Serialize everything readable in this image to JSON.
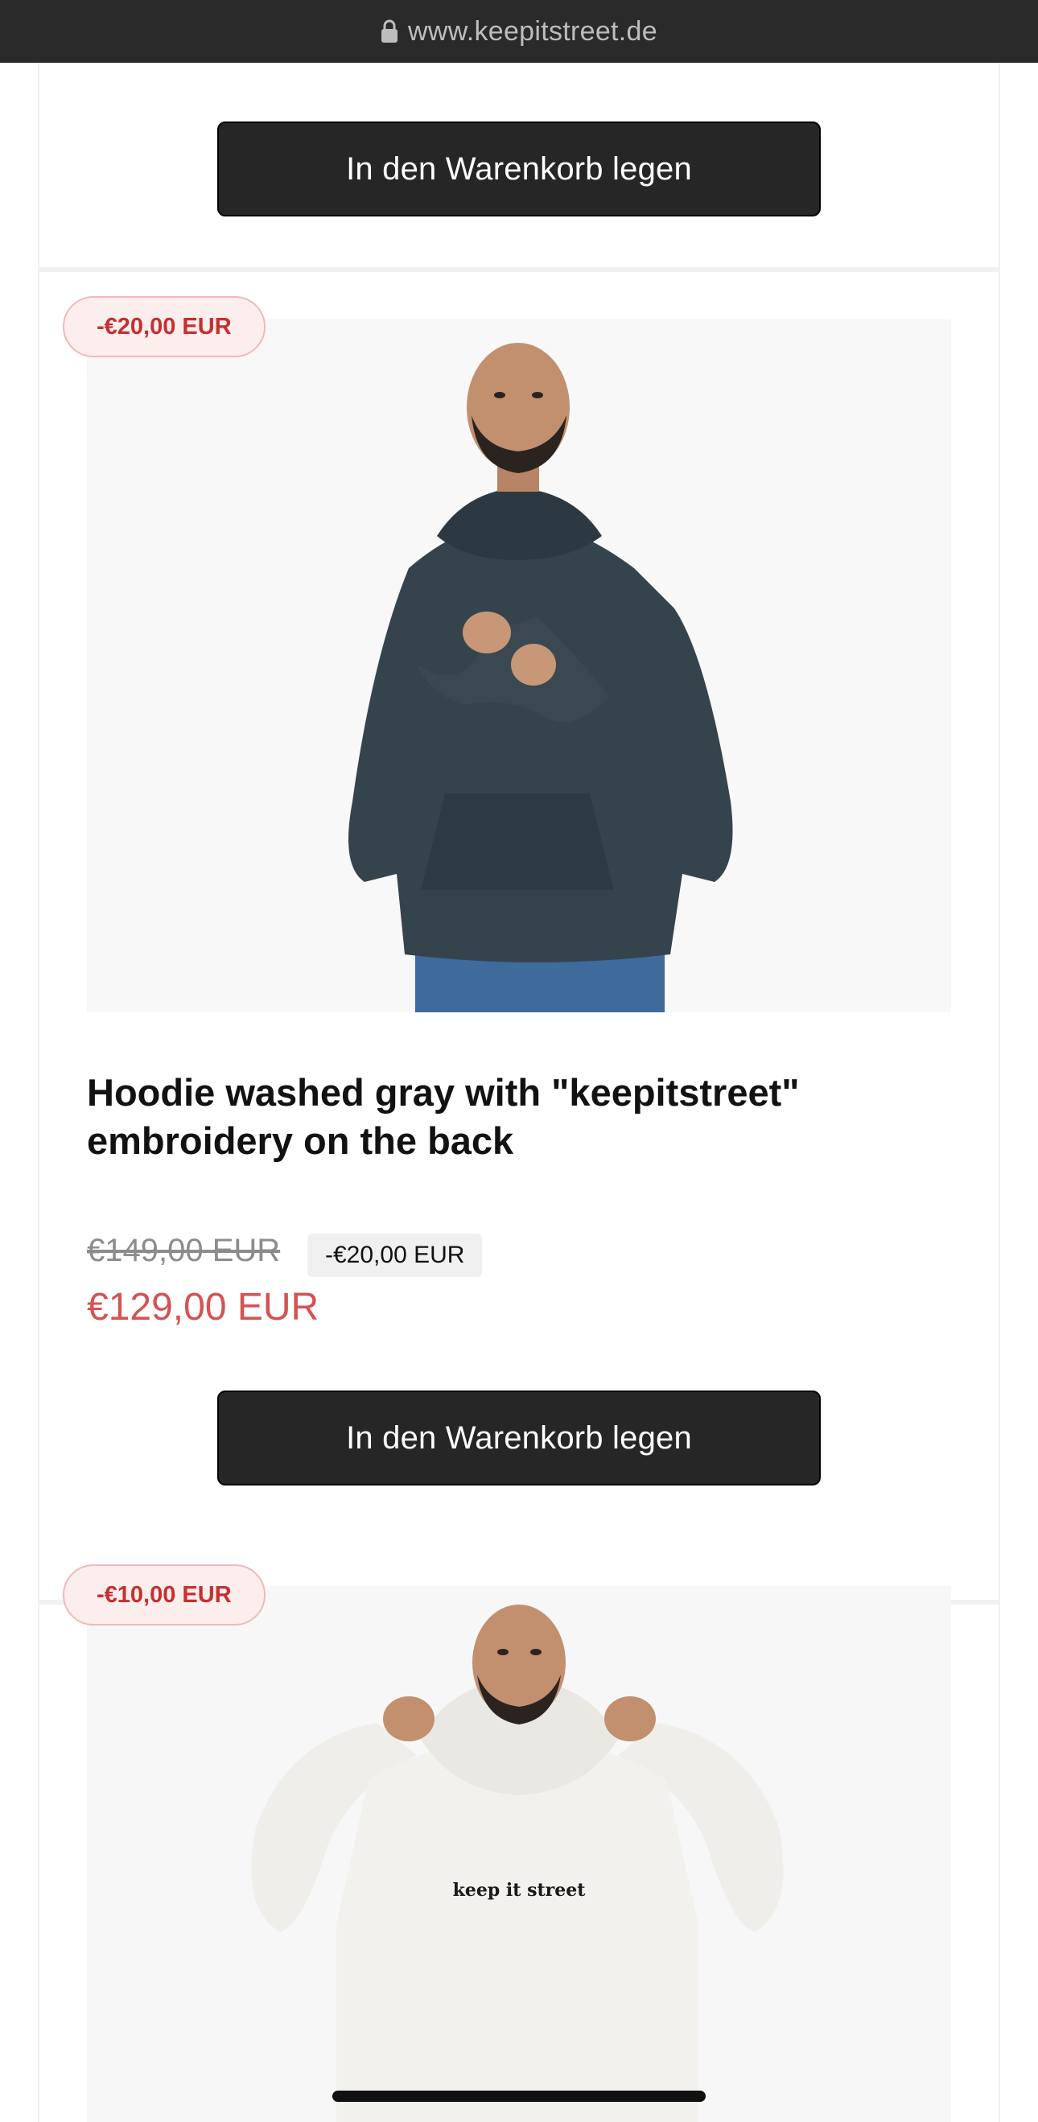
{
  "browser": {
    "url": "www.keepitstreet.de"
  },
  "products": [
    {
      "cart_label": "In den Warenkorb legen"
    },
    {
      "badge": "-€20,00 EUR",
      "title_line1": "Hoodie washed gray with \"keepitstreet\"",
      "title_line2": "embroidery on the back",
      "old_price": "€149,00 EUR",
      "discount": "-€20,00 EUR",
      "sale_price": "€129,00 EUR",
      "cart_label": "In den Warenkorb legen"
    },
    {
      "badge": "-€10,00 EUR",
      "print_text": "keep it street"
    }
  ],
  "colors": {
    "badge_text": "#c62f2f",
    "sale_price": "#d55252",
    "button_bg": "#262626"
  }
}
